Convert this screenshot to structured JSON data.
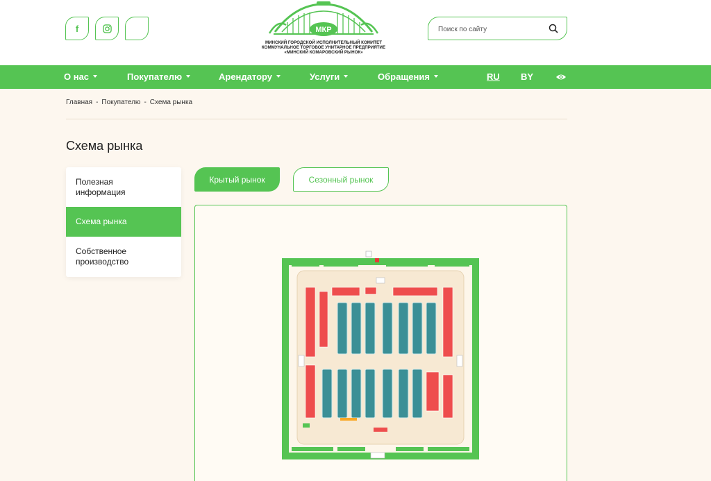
{
  "header": {
    "social": [
      {
        "name": "facebook",
        "glyph": "f"
      },
      {
        "name": "instagram",
        "glyph": ""
      },
      {
        "name": "leaf",
        "glyph": ""
      }
    ],
    "logo": {
      "abbr": "МКР",
      "lines": [
        "МИНСКИЙ ГОРОДСКОЙ ИСПОЛНИТЕЛЬНЫЙ КОМИТЕТ",
        "КОММУНАЛЬНОЕ ТОРГОВОЕ УНИТАРНОЕ ПРЕДПРИЯТИЕ",
        "«МИНСКИЙ КОМАРОВСКИЙ РЫНОК»"
      ]
    },
    "search": {
      "placeholder": "Поиск по сайту"
    }
  },
  "nav": {
    "items": [
      "О нас",
      "Покупателю",
      "Арендатору",
      "Услуги",
      "Обращения"
    ],
    "languages": [
      "RU",
      "BY"
    ],
    "active_language": "RU"
  },
  "breadcrumb": [
    "Главная",
    "Покупателю",
    "Схема рынка"
  ],
  "page": {
    "title": "Схема рынка"
  },
  "sidebar": {
    "items": [
      {
        "label": "Полезная информация",
        "active": false
      },
      {
        "label": "Схема рынка",
        "active": true
      },
      {
        "label": "Собственное производство",
        "active": false
      }
    ]
  },
  "tabs": [
    {
      "label": "Крытый рынок",
      "active": true
    },
    {
      "label": "Сезонный рынок",
      "active": false
    }
  ],
  "colors": {
    "brand": "#55c453",
    "stall_red": "#ee4d4d",
    "stall_teal": "#3b8f96",
    "floor": "#f7e9d3"
  }
}
